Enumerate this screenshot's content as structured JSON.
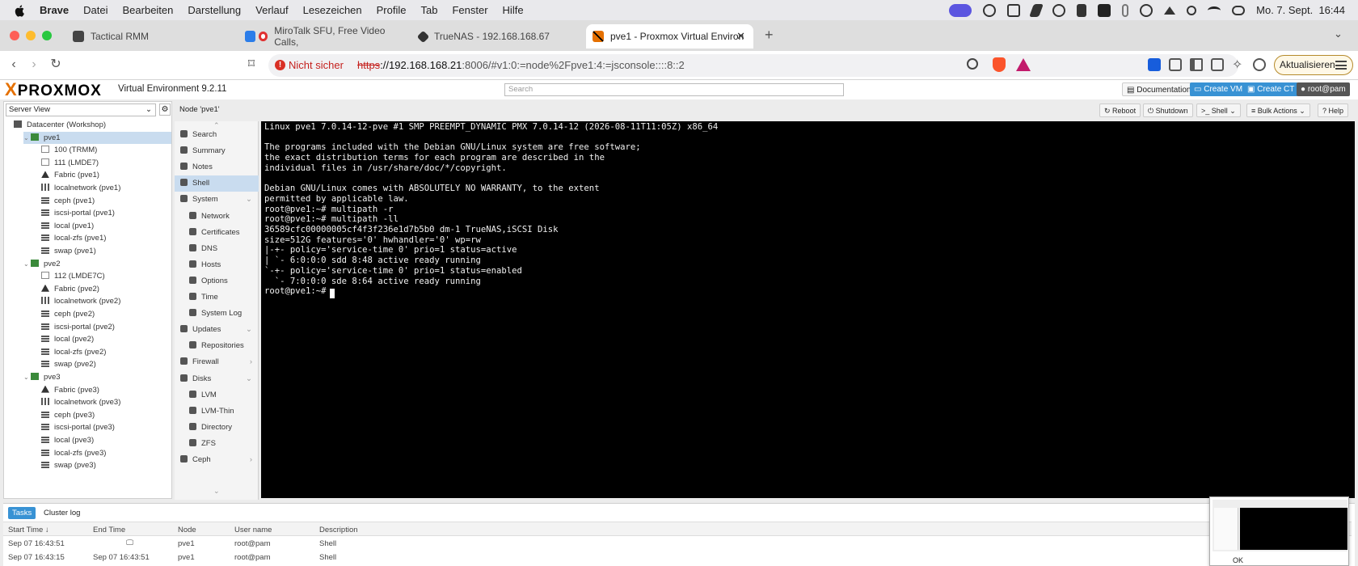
{
  "menubar": {
    "app": "Brave",
    "items": [
      "Datei",
      "Bearbeiten",
      "Darstellung",
      "Verlauf",
      "Lesezeichen",
      "Profile",
      "Tab",
      "Fenster",
      "Hilfe"
    ],
    "clock": "Mo. 7. Sept.  16:44"
  },
  "tabs": [
    {
      "title": "Tactical RMM",
      "icon": "tactical-rmm-icon"
    },
    {
      "title": "MiroTalk SFU, Free Video Calls,",
      "icon": "mirotalk-icon"
    },
    {
      "title": "TrueNAS - 192.168.168.67",
      "icon": "truenas-icon"
    },
    {
      "title": "pve1 - Proxmox Virtual Environ",
      "icon": "proxmox-icon",
      "active": true
    }
  ],
  "urlbar": {
    "security": "Nicht sicher",
    "scheme": "https",
    "host": "://192.168.168.21",
    "rest": ":8006/#v1:0:=node%2Fpve1:4:=jsconsole::::8::2",
    "update_label": "Aktualisieren"
  },
  "pve": {
    "logo": "PROXMOX",
    "product": "Virtual Environment 9.2.11",
    "search_placeholder": "Search",
    "doc_label": "Documentation",
    "create_vm": "Create VM",
    "create_ct": "Create CT",
    "user": "root@pam",
    "view_select": "Server View",
    "node_title": "Node 'pve1'",
    "actions": {
      "reboot": "Reboot",
      "shutdown": "Shutdown",
      "shell": "Shell",
      "bulk": "Bulk Actions",
      "help": "Help"
    }
  },
  "tree": [
    {
      "label": "Datacenter (Workshop)",
      "level": 0,
      "icon": "datacenter-icon"
    },
    {
      "label": "pve1",
      "level": 1,
      "icon": "node-icon",
      "selected": true
    },
    {
      "label": "100 (TRMM)",
      "level": 2,
      "icon": "vm-icon"
    },
    {
      "label": "111 (LMDE7)",
      "level": 2,
      "icon": "vm-icon"
    },
    {
      "label": "Fabric (pve1)",
      "level": 2,
      "icon": "fabric-icon"
    },
    {
      "label": "localnetwork (pve1)",
      "level": 2,
      "icon": "network-icon"
    },
    {
      "label": "ceph (pve1)",
      "level": 2,
      "icon": "storage-icon"
    },
    {
      "label": "iscsi-portal (pve1)",
      "level": 2,
      "icon": "storage-icon"
    },
    {
      "label": "local (pve1)",
      "level": 2,
      "icon": "storage-icon"
    },
    {
      "label": "local-zfs (pve1)",
      "level": 2,
      "icon": "storage-icon"
    },
    {
      "label": "swap (pve1)",
      "level": 2,
      "icon": "storage-icon"
    },
    {
      "label": "pve2",
      "level": 1,
      "icon": "node-icon"
    },
    {
      "label": "112 (LMDE7C)",
      "level": 2,
      "icon": "vm-icon"
    },
    {
      "label": "Fabric (pve2)",
      "level": 2,
      "icon": "fabric-icon"
    },
    {
      "label": "localnetwork (pve2)",
      "level": 2,
      "icon": "network-icon"
    },
    {
      "label": "ceph (pve2)",
      "level": 2,
      "icon": "storage-icon"
    },
    {
      "label": "iscsi-portal (pve2)",
      "level": 2,
      "icon": "storage-icon"
    },
    {
      "label": "local (pve2)",
      "level": 2,
      "icon": "storage-icon"
    },
    {
      "label": "local-zfs (pve2)",
      "level": 2,
      "icon": "storage-icon"
    },
    {
      "label": "swap (pve2)",
      "level": 2,
      "icon": "storage-icon"
    },
    {
      "label": "pve3",
      "level": 1,
      "icon": "node-icon"
    },
    {
      "label": "Fabric (pve3)",
      "level": 2,
      "icon": "fabric-icon"
    },
    {
      "label": "localnetwork (pve3)",
      "level": 2,
      "icon": "network-icon"
    },
    {
      "label": "ceph (pve3)",
      "level": 2,
      "icon": "storage-icon"
    },
    {
      "label": "iscsi-portal (pve3)",
      "level": 2,
      "icon": "storage-icon"
    },
    {
      "label": "local (pve3)",
      "level": 2,
      "icon": "storage-icon"
    },
    {
      "label": "local-zfs (pve3)",
      "level": 2,
      "icon": "storage-icon"
    },
    {
      "label": "swap (pve3)",
      "level": 2,
      "icon": "storage-icon"
    }
  ],
  "nav": [
    {
      "label": "Search",
      "sub": false,
      "icon": "search-icon"
    },
    {
      "label": "Summary",
      "sub": false,
      "icon": "summary-icon"
    },
    {
      "label": "Notes",
      "sub": false,
      "icon": "notes-icon"
    },
    {
      "label": "Shell",
      "sub": false,
      "icon": "terminal-icon",
      "active": true
    },
    {
      "label": "System",
      "sub": false,
      "icon": "gear-icon",
      "expander": true
    },
    {
      "label": "Network",
      "sub": true,
      "icon": "network-icon"
    },
    {
      "label": "Certificates",
      "sub": true,
      "icon": "certificate-icon"
    },
    {
      "label": "DNS",
      "sub": true,
      "icon": "globe-icon"
    },
    {
      "label": "Hosts",
      "sub": true,
      "icon": "hosts-icon"
    },
    {
      "label": "Options",
      "sub": true,
      "icon": "options-icon"
    },
    {
      "label": "Time",
      "sub": true,
      "icon": "clock-icon"
    },
    {
      "label": "System Log",
      "sub": true,
      "icon": "log-icon"
    },
    {
      "label": "Updates",
      "sub": false,
      "icon": "refresh-icon",
      "expander": true
    },
    {
      "label": "Repositories",
      "sub": true,
      "icon": "repository-icon"
    },
    {
      "label": "Firewall",
      "sub": false,
      "icon": "shield-icon",
      "collapsed": true
    },
    {
      "label": "Disks",
      "sub": false,
      "icon": "disk-icon",
      "expander": true
    },
    {
      "label": "LVM",
      "sub": true,
      "icon": "lvm-icon"
    },
    {
      "label": "LVM-Thin",
      "sub": true,
      "icon": "lvm-thin-icon"
    },
    {
      "label": "Directory",
      "sub": true,
      "icon": "folder-icon"
    },
    {
      "label": "ZFS",
      "sub": true,
      "icon": "zfs-icon"
    },
    {
      "label": "Ceph",
      "sub": false,
      "icon": "ceph-icon",
      "collapsed": true
    }
  ],
  "terminal": [
    "Linux pve1 7.0.14-12-pve #1 SMP PREEMPT_DYNAMIC PMX 7.0.14-12 (2026-08-11T11:05Z) x86_64",
    "",
    "The programs included with the Debian GNU/Linux system are free software;",
    "the exact distribution terms for each program are described in the",
    "individual files in /usr/share/doc/*/copyright.",
    "",
    "Debian GNU/Linux comes with ABSOLUTELY NO WARRANTY, to the extent",
    "permitted by applicable law.",
    "root@pve1:~# multipath -r",
    "root@pve1:~# multipath -ll",
    "36589cfc00000005cf4f3f236e1d7b5b0 dm-1 TrueNAS,iSCSI Disk",
    "size=512G features='0' hwhandler='0' wp=rw",
    "|-+- policy='service-time 0' prio=1 status=active",
    "| `- 6:0:0:0 sdd 8:48 active ready running",
    "`-+- policy='service-time 0' prio=1 status=enabled",
    "  `- 7:0:0:0 sde 8:64 active ready running",
    "root@pve1:~# "
  ],
  "bottom": {
    "tabs": [
      "Tasks",
      "Cluster log"
    ],
    "columns": [
      "Start Time ↓",
      "End Time",
      "Node",
      "User name",
      "Description"
    ],
    "rows": [
      [
        "Sep 07 16:43:51",
        "",
        "pve1",
        "root@pam",
        "Shell"
      ],
      [
        "Sep 07 16:43:15",
        "Sep 07 16:43:51",
        "pve1",
        "root@pam",
        "Shell"
      ]
    ],
    "ok_label": "OK"
  }
}
